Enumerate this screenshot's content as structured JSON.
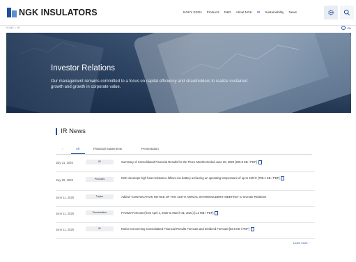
{
  "header": {
    "logo_text": "NGK INSULATORS",
    "nav": [
      {
        "label": "NGK's SDGs"
      },
      {
        "label": "Products"
      },
      {
        "label": "R&D"
      },
      {
        "label": "About NGK"
      },
      {
        "label": "IR"
      },
      {
        "label": "Sustainability"
      },
      {
        "label": "News"
      }
    ],
    "active_nav": "IR",
    "buttons": [
      {
        "icon": "gear-icon"
      },
      {
        "icon": "search-icon"
      }
    ]
  },
  "breadcrumb": "HOME  >  IR",
  "language": "EN",
  "hero": {
    "title": "Investor Relations",
    "subtitle": "Our management remains committed to a focus on capital efficiency and shareholders to realize sustained growth and growth in corporate value."
  },
  "ir_news": {
    "heading": "IR News",
    "tabs": [
      {
        "label": "‹"
      },
      {
        "label": "All"
      },
      {
        "label": "Financial Statements"
      },
      {
        "label": "Presentation"
      }
    ],
    "active_tab": "All",
    "items": [
      {
        "date": "July 31, 2020",
        "category": "IR",
        "title": "Summary of Consolidated Financial Results for the Three Months Ended June 30, 2020 [205.9 KB / PDF]"
      },
      {
        "date": "July 29, 2020",
        "category": "Products",
        "title": "NGK develops high heat resistance lithium-ion battery achieving an operating temperature of up to 105°C [798.1 KB / PDF]"
      },
      {
        "date": "June 11, 2020",
        "category": "Topics",
        "title": "Added \"CONVOCATION NOTICE OF THE 154TH ANNUAL SHAREHOLDERS' MEETING\" to Investor Relations"
      },
      {
        "date": "June 11, 2020",
        "category": "Presentation",
        "title": "FY2020 Forecast (from April 1, 2020 to March 31, 2021) [1.3 MB / PDF]"
      },
      {
        "date": "June 11, 2020",
        "category": "IR",
        "title": "Notice Concerning Consolidated Financial Results Forecast and Dividend Forecast [63.6 KB / PDF]"
      }
    ],
    "learn_more": "Learn more ›"
  },
  "colors": {
    "accent": "#1e4f9c",
    "tag_bg": "#eceef1"
  }
}
